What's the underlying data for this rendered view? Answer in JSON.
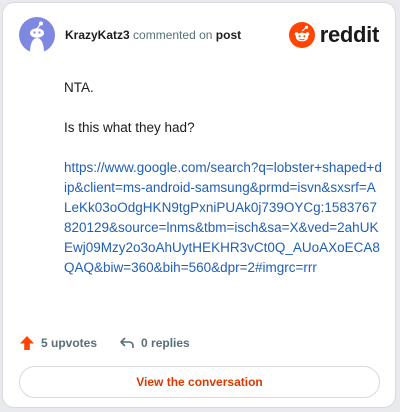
{
  "header": {
    "username": "KrazyKatz3",
    "action": "commented on",
    "post_link": "post",
    "brand": "reddit"
  },
  "comment": {
    "lines": [
      "NTA.",
      "Is this what they had?"
    ],
    "url": "https://www.google.com/search?q=lobster+shaped+dip&client=ms-android-samsung&prmd=isvn&sxsrf=ALeKk03oOdgHKN9tgPxniPUAk0j739OYCg:1583767820129&source=lnms&tbm=isch&sa=X&ved=2ahUKEwj09Mzy2o3oAhUytHEKHR3vCt0Q_AUoAXoECA8QAQ&biw=360&bih=560&dpr=2#imgrc=rrr"
  },
  "stats": {
    "upvotes": "5 upvotes",
    "replies": "0 replies"
  },
  "cta": {
    "label": "View the conversation"
  },
  "colors": {
    "accent": "#ff4500",
    "link": "#1f5fb8",
    "cta_text": "#d93a00",
    "avatar_bg": "#7f88e0"
  }
}
